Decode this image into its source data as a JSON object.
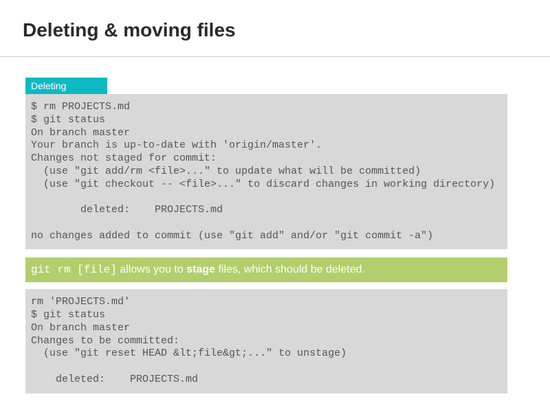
{
  "title": "Deleting & moving files",
  "tab": {
    "label": "Deleting"
  },
  "code1": "$ rm PROJECTS.md\n$ git status\nOn branch master\nYour branch is up-to-date with 'origin/master'.\nChanges not staged for commit:\n  (use \"git add/rm <file>...\" to update what will be committed)\n  (use \"git checkout -- <file>...\" to discard changes in working directory)\n\n        deleted:    PROJECTS.md\n\nno changes added to commit (use \"git add\" and/or \"git commit -a\")",
  "callout": {
    "cmd": "git rm [file]",
    "part1": " allows you to ",
    "bold": "stage",
    "part2": " files, which should be deleted."
  },
  "code2": "rm 'PROJECTS.md'\n$ git status\nOn branch master\nChanges to be committed:\n  (use \"git reset HEAD &lt;file&gt;...\" to unstage)\n\n    deleted:    PROJECTS.md",
  "colors": {
    "accent": "#0fb9c2",
    "callout": "#b3ce6c",
    "codebg": "#d8d8d8"
  }
}
